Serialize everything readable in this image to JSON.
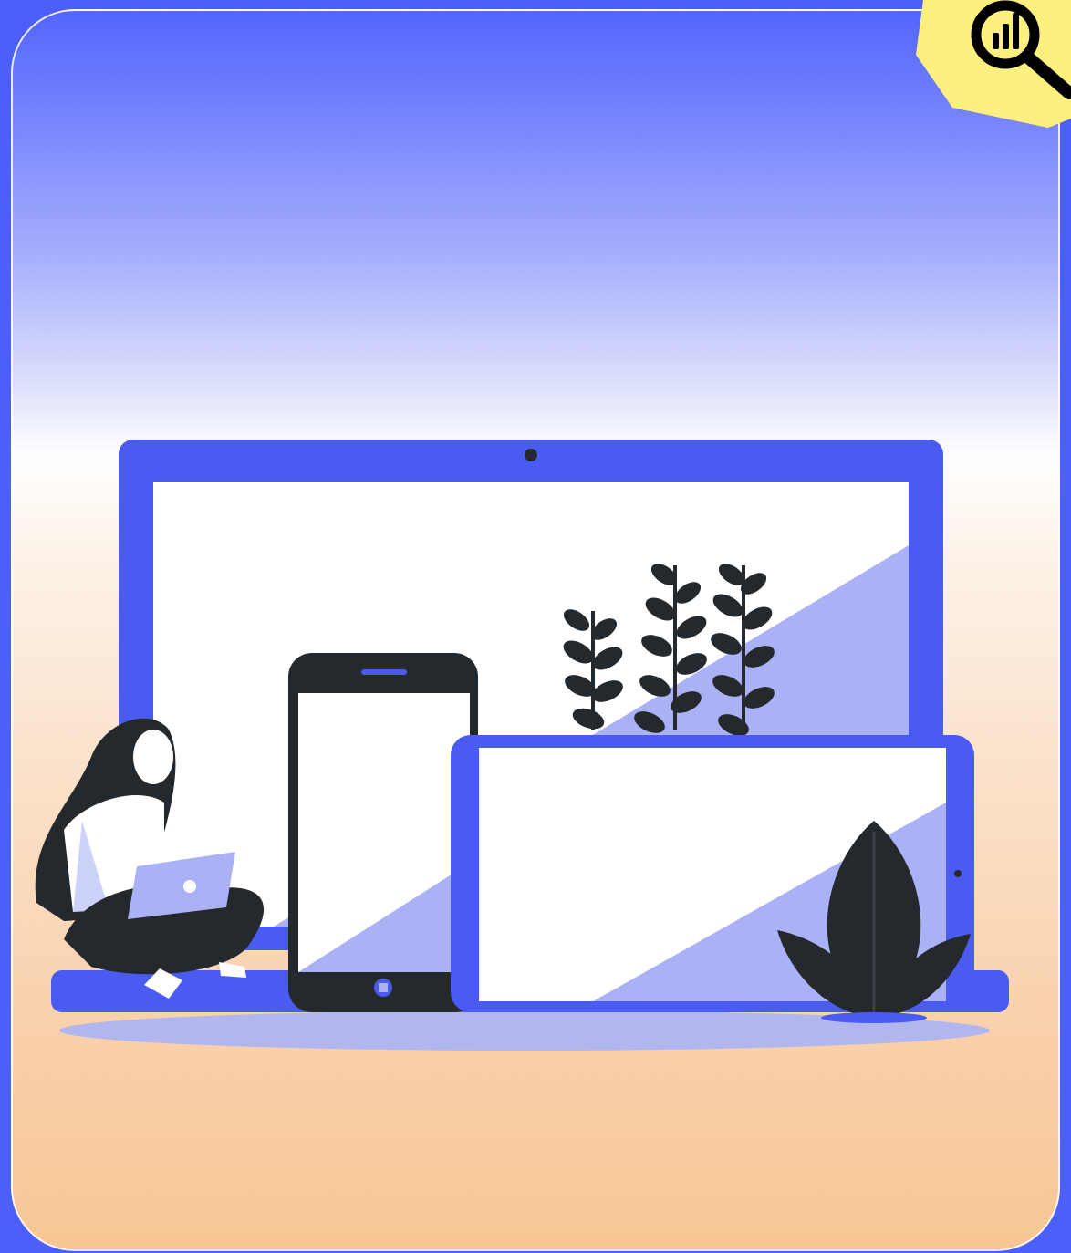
{
  "badge": {
    "icon": "magnifier-chart-icon",
    "color": "#fdf07e"
  },
  "illustration": {
    "subject": "devices-illustration",
    "devices": [
      "laptop",
      "smartphone",
      "tablet"
    ],
    "colors": {
      "accent": "#4a5bf2",
      "light_accent": "#aab2f5",
      "dark": "#24292e",
      "screen": "#ffffff"
    }
  }
}
